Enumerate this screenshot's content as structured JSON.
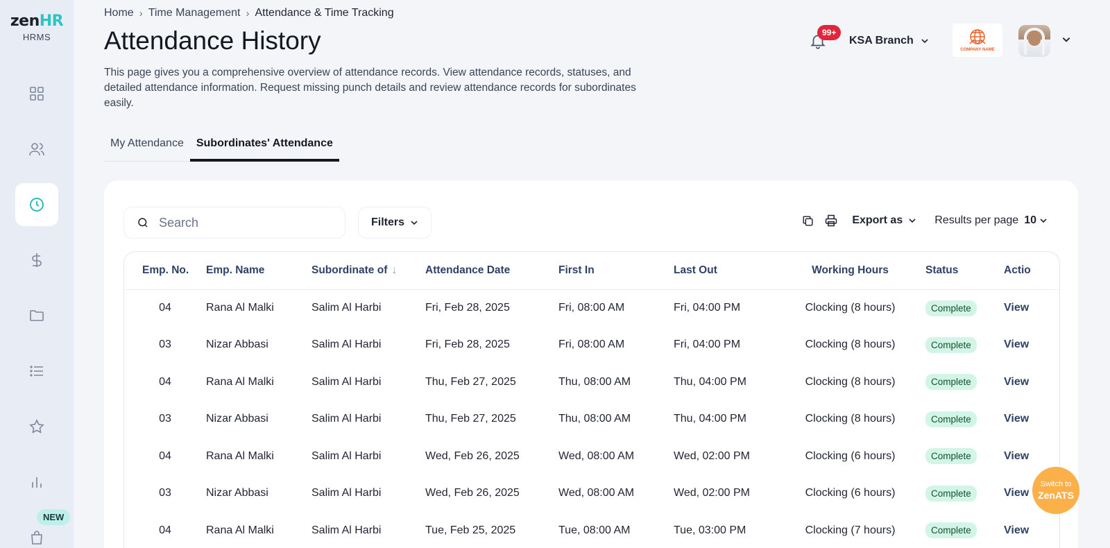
{
  "sidebar": {
    "logo_main": "zen",
    "logo_accent": "HR",
    "logo_sub": "HRMS",
    "new_badge": "NEW"
  },
  "breadcrumb": [
    "Home",
    "Time Management",
    "Attendance & Time Tracking"
  ],
  "page": {
    "title": "Attendance History",
    "description": "This page gives you a comprehensive overview of attendance records. View attendance records, statuses, and detailed attendance information. Request missing punch details and review attendance records for subordinates easily."
  },
  "header": {
    "notification_count": "99+",
    "branch": "KSA Branch",
    "company_logo_text": "COMPANY NAME"
  },
  "tabs": [
    {
      "label": "My Attendance",
      "active": false
    },
    {
      "label": "Subordinates' Attendance",
      "active": true
    }
  ],
  "toolbar": {
    "search_placeholder": "Search",
    "filters_label": "Filters",
    "export_label": "Export as",
    "results_label": "Results per page",
    "results_value": "10"
  },
  "table": {
    "columns": [
      "Emp. No.",
      "Emp. Name",
      "Subordinate of",
      "Attendance Date",
      "First In",
      "Last Out",
      "Working Hours",
      "Status",
      "Actio"
    ],
    "rows": [
      {
        "no": "04",
        "name": "Rana Al Malki",
        "sub": "Salim Al Harbi",
        "date": "Fri, Feb 28, 2025",
        "in": "Fri, 08:00 AM",
        "out": "Fri, 04:00 PM",
        "hours": "Clocking (8 hours)",
        "status": "Complete",
        "action": "View"
      },
      {
        "no": "03",
        "name": "Nizar Abbasi",
        "sub": "Salim Al Harbi",
        "date": "Fri, Feb 28, 2025",
        "in": "Fri, 08:00 AM",
        "out": "Fri, 04:00 PM",
        "hours": "Clocking (8 hours)",
        "status": "Complete",
        "action": "View"
      },
      {
        "no": "04",
        "name": "Rana Al Malki",
        "sub": "Salim Al Harbi",
        "date": "Thu, Feb 27, 2025",
        "in": "Thu, 08:00 AM",
        "out": "Thu, 04:00 PM",
        "hours": "Clocking (8 hours)",
        "status": "Complete",
        "action": "View"
      },
      {
        "no": "03",
        "name": "Nizar Abbasi",
        "sub": "Salim Al Harbi",
        "date": "Thu, Feb 27, 2025",
        "in": "Thu, 08:00 AM",
        "out": "Thu, 04:00 PM",
        "hours": "Clocking (8 hours)",
        "status": "Complete",
        "action": "View"
      },
      {
        "no": "04",
        "name": "Rana Al Malki",
        "sub": "Salim Al Harbi",
        "date": "Wed, Feb 26, 2025",
        "in": "Wed, 08:00 AM",
        "out": "Wed, 02:00 PM",
        "hours": "Clocking (6 hours)",
        "status": "Complete",
        "action": "View"
      },
      {
        "no": "03",
        "name": "Nizar Abbasi",
        "sub": "Salim Al Harbi",
        "date": "Wed, Feb 26, 2025",
        "in": "Wed, 08:00 AM",
        "out": "Wed, 02:00 PM",
        "hours": "Clocking (6 hours)",
        "status": "Complete",
        "action": "View"
      },
      {
        "no": "04",
        "name": "Rana Al Malki",
        "sub": "Salim Al Harbi",
        "date": "Tue, Feb 25, 2025",
        "in": "Tue, 08:00 AM",
        "out": "Tue, 03:00 PM",
        "hours": "Clocking (7 hours)",
        "status": "Complete",
        "action": "View"
      }
    ]
  },
  "ats_button": {
    "line1": "Switch to",
    "line2": "ZenATS"
  },
  "colors": {
    "accent": "#2ec4c6",
    "header_text": "#2f4166",
    "status_bg": "#d3f5e7",
    "notification": "#e0263c",
    "ats": "#fbb04a"
  }
}
